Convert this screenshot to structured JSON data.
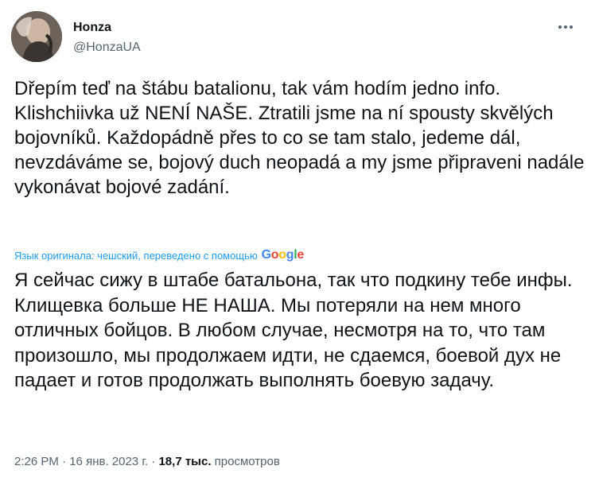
{
  "author": {
    "name": "Honza",
    "handle": "@HonzaUA"
  },
  "tweet": {
    "text": "Dřepím teď na štábu batalionu, tak vám hodím jedno info. Klishchiivka už NENÍ NAŠE. Ztratili jsme na ní spousty skvělých bojovníků. Každopádně přes to co se tam stalo, jedeme dál, nevzdáváme se, bojový duch neopadá a my jsme připraveni nadále vykonávat bojové zadání.",
    "translation_note": "Язык оригинала: чешский, переведено с помощью",
    "translated_text": "Я сейчас сижу в штабе батальона, так что подкину тебе инфы. Клищевка больше НЕ НАША. Мы потеряли на нем много отличных бойцов. В любом случае, несмотря на то, что там произошло, мы продолжаем идти, не сдаемся, боевой дух не падает и готов продолжать выполнять боевую задачу."
  },
  "meta": {
    "time": "2:26 PM",
    "separator": "·",
    "date": "16 янв. 2023 г.",
    "views_count": "18,7 тыс.",
    "views_label": "просмотров"
  },
  "icons": {
    "more": "more-horizontal-icon",
    "translation_provider": "google-logo"
  },
  "colors": {
    "text": "#0f1419",
    "secondary": "#536471",
    "link": "#1d9bf0"
  }
}
